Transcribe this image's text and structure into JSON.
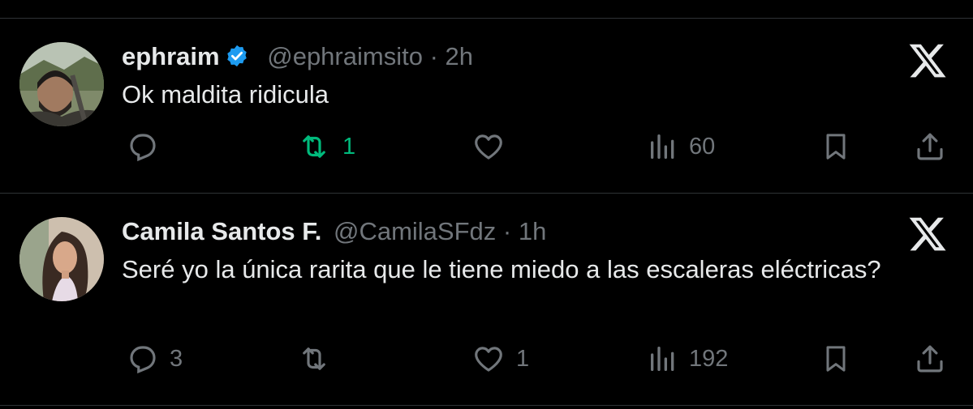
{
  "tweets": [
    {
      "name": "ephraim",
      "verified": true,
      "handle": "@ephraimsito",
      "time": "2h",
      "text": "Ok maldita ridicula",
      "replies": "",
      "retweets": "1",
      "retweeted": true,
      "likes": "",
      "views": "60"
    },
    {
      "name": "Camila Santos F.",
      "verified": false,
      "handle": "@CamilaSFdz",
      "time": "1h",
      "text": "Seré yo la única rarita que le tiene miedo a las escaleras eléctricas?",
      "replies": "3",
      "retweets": "",
      "retweeted": false,
      "likes": "1",
      "views": "192"
    }
  ],
  "colors": {
    "background": "#000000",
    "text": "#e7e9ea",
    "muted": "#71767b",
    "retweet_active": "#00ba7c",
    "verified": "#1d9bf0",
    "divider": "#2f3336"
  },
  "icons": [
    "x-logo-icon",
    "verified-badge-icon",
    "reply-icon",
    "retweet-icon",
    "like-icon",
    "views-icon",
    "bookmark-icon",
    "share-icon"
  ]
}
